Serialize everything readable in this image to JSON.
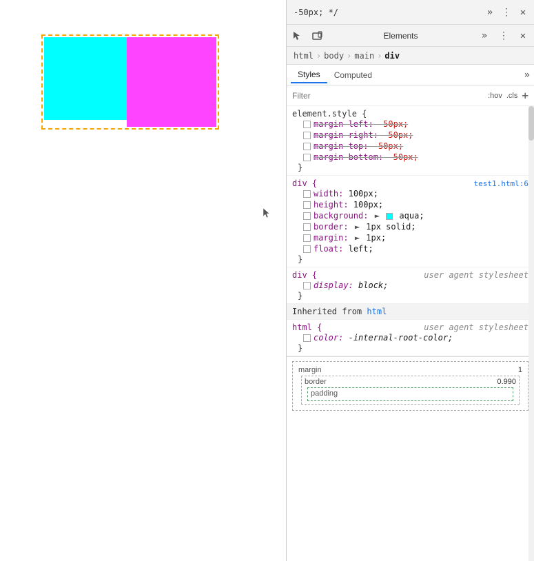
{
  "preview": {
    "cyan_box_color": "cyan",
    "magenta_box_color": "#ff44ff"
  },
  "devtools": {
    "topbar": {
      "title": "Elements",
      "more_icon": "»",
      "menu_icon": "⋮",
      "close_icon": "✕",
      "cursor_icon": "↖",
      "device_icon": "▭"
    },
    "breadcrumb": {
      "items": [
        "html",
        "body",
        "main",
        "div"
      ]
    },
    "styles_tab": "Styles",
    "computed_tab": "Computed",
    "more_tab_icon": "»",
    "filter": {
      "placeholder": "Filter",
      "hov_label": ":hov",
      "cls_label": ".cls",
      "plus_label": "+"
    },
    "code_snippet": {
      "line1": "-50px; */",
      "element_style_open": "element.style {",
      "margin_left": "margin-left: -50px;",
      "margin_right": "margin-right: -50px;",
      "margin_top": "margin-top: -50px;",
      "margin_bottom": "margin-bottom: -50px;",
      "close_brace": "}"
    },
    "div_rule": {
      "selector": "div {",
      "source": "test1.html:6",
      "width": "width: 100px;",
      "height": "height: 100px;",
      "background_label": "background:",
      "background_color": "aqua;",
      "border_label": "border:",
      "border_value": "1px solid;",
      "margin_label": "margin:",
      "margin_value": "1px;",
      "float_label": "float:",
      "float_value": "left;",
      "close_brace": "}"
    },
    "div_ua_rule": {
      "selector": "div {",
      "comment": "user agent stylesheet",
      "display_label": "display:",
      "display_value": "block;",
      "close_brace": "}"
    },
    "inherited_header": "Inherited from",
    "inherited_element": "html",
    "html_ua_rule": {
      "selector": "html {",
      "comment": "user agent stylesheet",
      "color_label": "color:",
      "color_value": "-internal-root-color;",
      "close_brace": "}"
    },
    "box_model": {
      "margin_label": "margin",
      "margin_value": "1",
      "border_label": "border",
      "border_value": "0.990",
      "padding_label": "padding"
    }
  }
}
